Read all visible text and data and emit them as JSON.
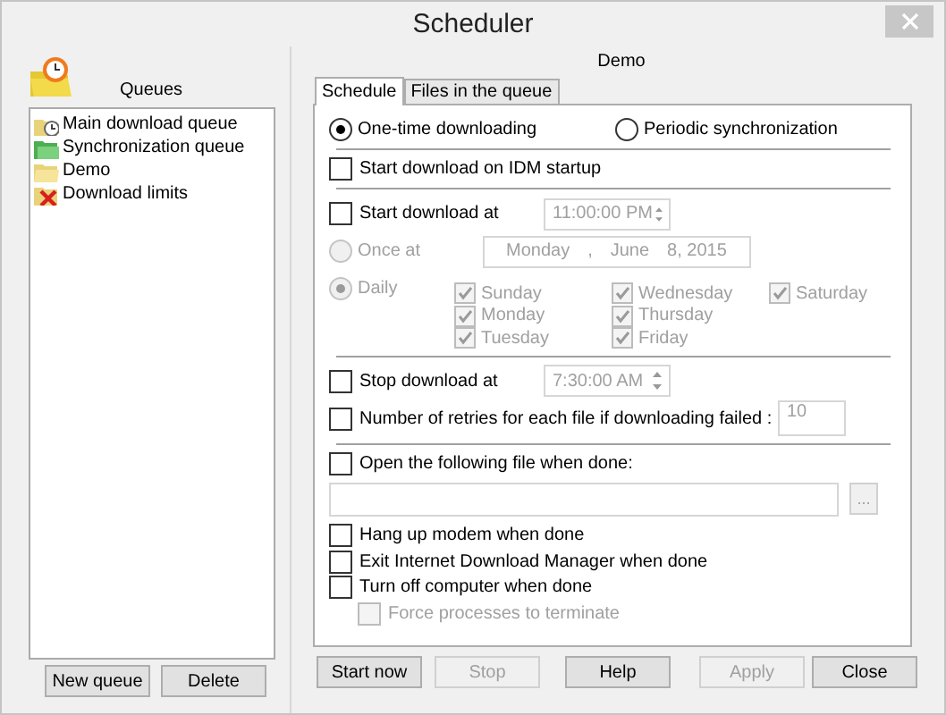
{
  "window": {
    "title": "Scheduler"
  },
  "queues": {
    "heading": "Queues",
    "items": [
      {
        "label": "Main download queue",
        "kind": "main"
      },
      {
        "label": "Synchronization queue",
        "kind": "sync"
      },
      {
        "label": "Demo",
        "kind": "folder"
      },
      {
        "label": "Download limits",
        "kind": "limits"
      }
    ],
    "buttons": [
      {
        "label": "New queue"
      },
      {
        "label": "Delete"
      }
    ]
  },
  "queue_title": "Demo",
  "tabs": [
    {
      "label": "Schedule",
      "selected": true
    },
    {
      "label": "Files in the queue",
      "selected": false
    }
  ],
  "schedule": {
    "modes": [
      {
        "label": "One-time downloading",
        "selected": true
      },
      {
        "label": "Periodic synchronization",
        "selected": false
      }
    ],
    "startup": {
      "label": "Start download on IDM startup",
      "checked": false
    },
    "start_at": {
      "label": "Start download at",
      "checked": false,
      "time": "11:00:00 PM"
    },
    "when": {
      "disabled": true,
      "once": {
        "label": "Once at",
        "selected": false
      },
      "date": [
        "Monday",
        ",",
        "June",
        "8, 2015"
      ],
      "daily": {
        "label": "Daily",
        "selected": true
      },
      "days": [
        {
          "label": "Sunday",
          "checked": true
        },
        {
          "label": "Monday",
          "checked": true
        },
        {
          "label": "Tuesday",
          "checked": true
        },
        {
          "label": "Wednesday",
          "checked": true
        },
        {
          "label": "Thursday",
          "checked": true
        },
        {
          "label": "Friday",
          "checked": true
        },
        {
          "label": "Saturday",
          "checked": true
        }
      ]
    },
    "stop_at": {
      "label": "Stop download at",
      "checked": false,
      "time": "7:30:00 AM"
    },
    "retries": {
      "label": "Number of retries for each file if downloading failed :",
      "checked": false,
      "value": "10"
    },
    "open_file": {
      "label": "Open the following file when done:",
      "checked": false,
      "browse": "..."
    },
    "options": [
      {
        "label": "Hang up modem when done",
        "checked": false
      },
      {
        "label": "Exit Internet Download Manager when done",
        "checked": false
      },
      {
        "label": "Turn off computer when done",
        "checked": false,
        "children": [
          {
            "label": "Force processes to terminate",
            "checked": false,
            "disabled": true
          }
        ]
      }
    ]
  },
  "buttons": [
    {
      "label": "Start now",
      "disabled": false
    },
    {
      "label": "Stop",
      "disabled": true
    },
    {
      "label": "Help",
      "disabled": false
    },
    {
      "label": "Apply",
      "disabled": true
    },
    {
      "label": "Close",
      "disabled": false
    }
  ]
}
